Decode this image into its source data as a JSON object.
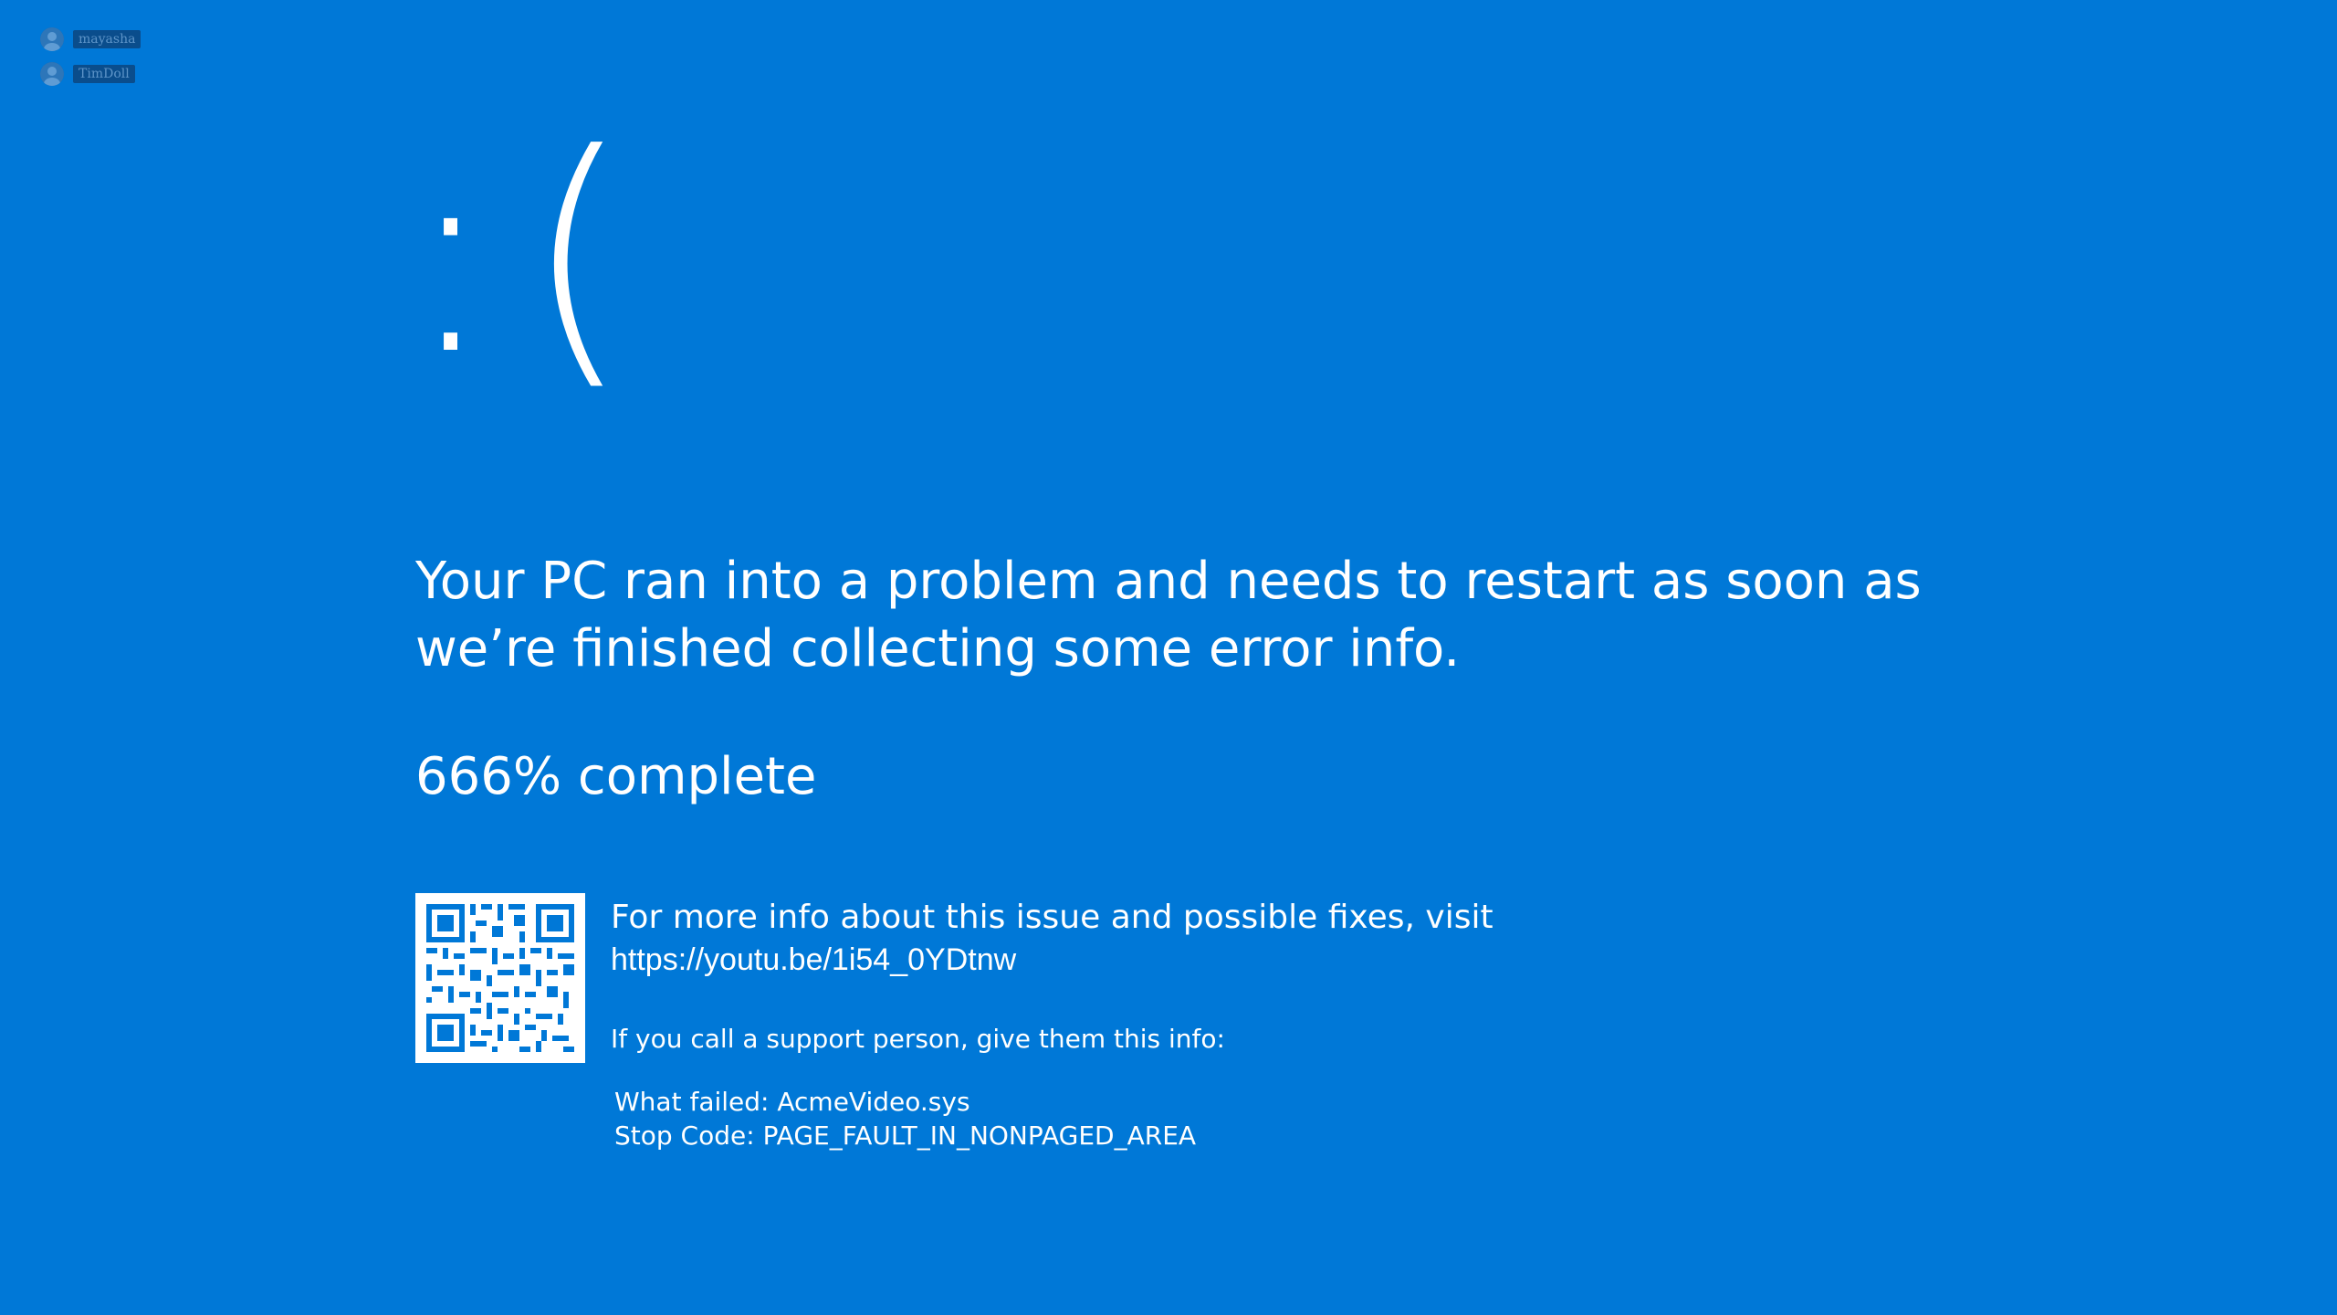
{
  "participants": [
    {
      "name": "mayasha",
      "icon": "user-avatar-icon"
    },
    {
      "name": "TimDoll",
      "icon": "user-avatar-icon"
    }
  ],
  "colors": {
    "background": "#0078d7",
    "text": "#ffffff"
  },
  "sad_face": ":(",
  "headline": "Your PC ran into a problem and needs to restart as soon as we’re finished collecting some error info.",
  "progress_text": "666% complete",
  "more_info_text": "For more info about this issue and possible fixes, visit",
  "link_url": "https://youtu.be/1i54_0YDtnw",
  "support_text": "If you call a support person, give them this info:",
  "what_failed": "What failed: AcmeVideo.sys",
  "stop_code": "Stop Code: PAGE_FAULT_IN_NONPAGED_AREA"
}
